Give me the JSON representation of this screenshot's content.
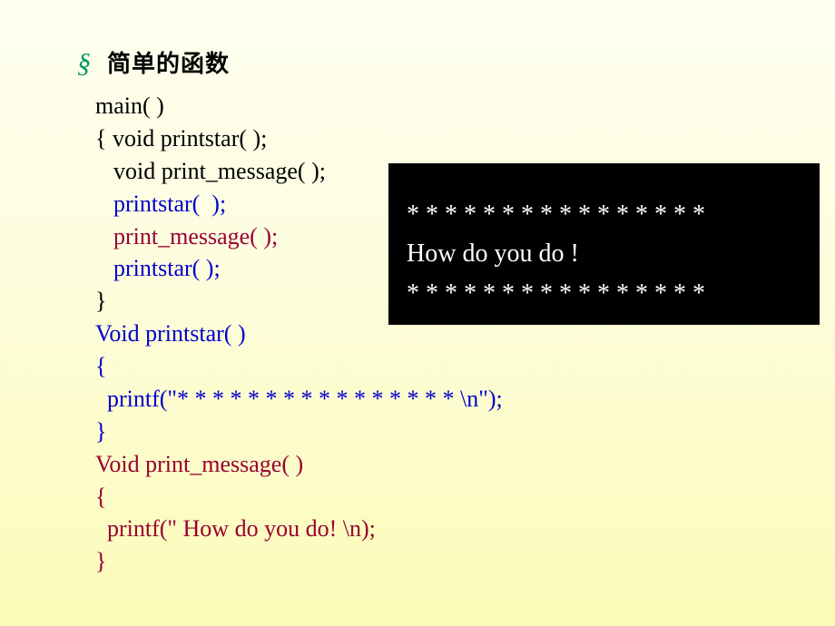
{
  "title": "简单的函数",
  "sectionMark": "§",
  "code": {
    "l1": "main( )",
    "l2": "{ void printstar( );",
    "l3": "void print_message( );",
    "l4": "printstar(  );",
    "l5": "print_message( );",
    "l6": "printstar( );",
    "l7": "}",
    "l8": "Void printstar( )",
    "l9": "{",
    "l10": "  printf(\"* * * * * * * * * * * * * * * * \\n\");",
    "l11": "}",
    "l12": "Void print_message( )",
    "l13": "{",
    "l14": "  printf(\" How do you do! \\n);",
    "l15": "}"
  },
  "output": {
    "l1": "* * * * * * * * * * * * * * * *",
    "l2": "How do you do !",
    "l3": "* * * * * * * * * * * * * * * *"
  }
}
